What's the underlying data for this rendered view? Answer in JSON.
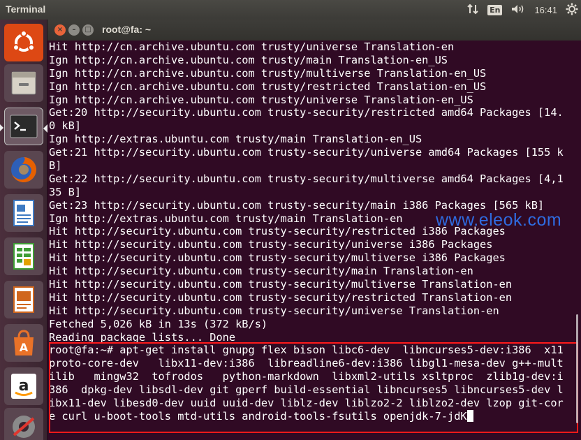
{
  "top_panel": {
    "app_title": "Terminal",
    "keyboard_layout": "En",
    "clock": "16:41",
    "icons": [
      "network-icon",
      "keyboard-icon",
      "volume-icon",
      "gear-icon"
    ]
  },
  "launcher": {
    "items": [
      {
        "name": "ubuntu-dash-icon",
        "color": "#dd4814"
      },
      {
        "name": "files-icon",
        "color": "#d8d2c7"
      },
      {
        "name": "terminal-icon",
        "color": "#2b2b2b",
        "active": true
      },
      {
        "name": "firefox-icon",
        "color": "#e66000"
      },
      {
        "name": "writer-icon",
        "color": "#3e7ac2"
      },
      {
        "name": "calc-icon",
        "color": "#3f9c35"
      },
      {
        "name": "impress-icon",
        "color": "#d0661d"
      },
      {
        "name": "software-center-icon",
        "color": "#e97228"
      },
      {
        "name": "amazon-icon",
        "color": "#ffffff"
      },
      {
        "name": "system-settings-icon",
        "color": "#8a8a8a"
      }
    ]
  },
  "window": {
    "title": "root@fa: ~"
  },
  "terminal": {
    "lines": [
      "Hit http://cn.archive.ubuntu.com trusty/universe Translation-en",
      "Ign http://cn.archive.ubuntu.com trusty/main Translation-en_US",
      "Ign http://cn.archive.ubuntu.com trusty/multiverse Translation-en_US",
      "Ign http://cn.archive.ubuntu.com trusty/restricted Translation-en_US",
      "Ign http://cn.archive.ubuntu.com trusty/universe Translation-en_US",
      "Get:20 http://security.ubuntu.com trusty-security/restricted amd64 Packages [14.",
      "0 kB]",
      "Ign http://extras.ubuntu.com trusty/main Translation-en_US",
      "Get:21 http://security.ubuntu.com trusty-security/universe amd64 Packages [155 k",
      "B]",
      "Get:22 http://security.ubuntu.com trusty-security/multiverse amd64 Packages [4,1",
      "35 B]",
      "Get:23 http://security.ubuntu.com trusty-security/main i386 Packages [565 kB]",
      "Ign http://extras.ubuntu.com trusty/main Translation-en",
      "Hit http://security.ubuntu.com trusty-security/restricted i386 Packages",
      "Hit http://security.ubuntu.com trusty-security/universe i386 Packages",
      "Hit http://security.ubuntu.com trusty-security/multiverse i386 Packages",
      "Hit http://security.ubuntu.com trusty-security/main Translation-en",
      "Hit http://security.ubuntu.com trusty-security/multiverse Translation-en",
      "Hit http://security.ubuntu.com trusty-security/restricted Translation-en",
      "Hit http://security.ubuntu.com trusty-security/universe Translation-en",
      "Fetched 5,026 kB in 13s (372 kB/s)",
      "Reading package lists... Done"
    ],
    "command_lines": [
      "root@fa:~# apt-get install gnupg flex bison libc6-dev  libncurses5-dev:i386  x11",
      "proto-core-dev   libx11-dev:i386  libreadline6-dev:i386 libgl1-mesa-dev g++-mult",
      "ilib   mingw32  tofrodos   python-markdown  libxml2-utils xsltproc  zlib1g-dev:i",
      "386  dpkg-dev libsdl-dev git gperf build-essential libncurses5 libncurses5-dev l",
      "ibx11-dev libesd0-dev uuid uuid-dev liblz-dev liblzo2-2 liblzo2-dev lzop git-cor",
      "e curl u-boot-tools mtd-utils android-tools-fsutils openjdk-7-jdK"
    ],
    "background": "#300a24",
    "text_color": "#ffffff",
    "highlight_color": "#ff1a1a"
  },
  "watermark": "www.eleok.com"
}
